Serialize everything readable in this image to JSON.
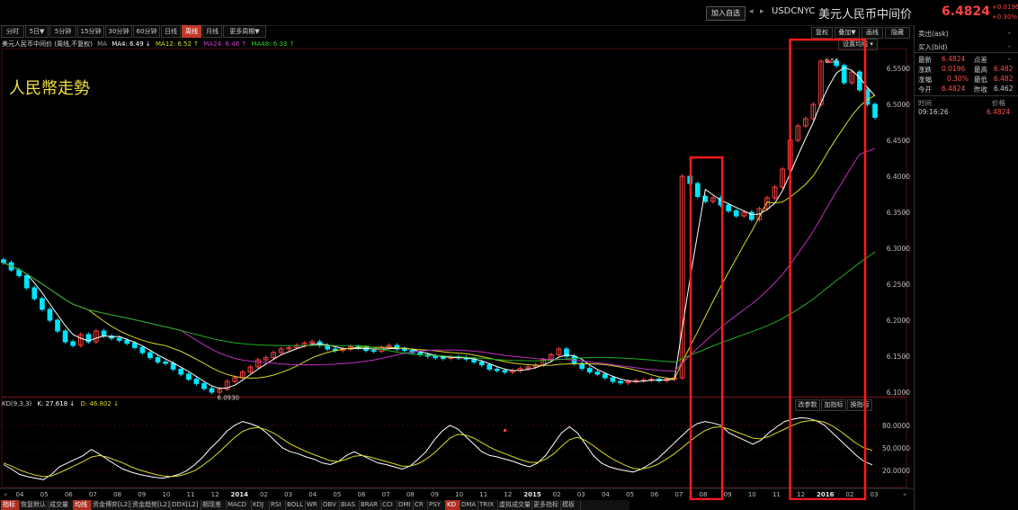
{
  "header": {
    "add_button": "加入自选",
    "symbol": "USDCNYC",
    "symbol_name": "美元人民币中间价",
    "price": "6.4824",
    "change": "+0.0196",
    "change_pct": "+0.30%"
  },
  "toolbar": {
    "periods": [
      "分时",
      "5日▼",
      "5分钟",
      "15分钟",
      "30分钟",
      "60分钟",
      "日线",
      "周线",
      "月线",
      "更多周期▼"
    ],
    "active_index": 7,
    "right_buttons": [
      "复权",
      "叠加▼",
      "画线",
      "隐藏"
    ],
    "ma_dropdown": "设置均线 ▾"
  },
  "legend": {
    "series_label": "美元人民币中间价 (周线,不复权)",
    "ma_label": "MA",
    "ma4": "MA4: 6.49 ↓",
    "ma12": "MA12: 6.52 ↑",
    "ma24": "MA24: 6.46 ↑",
    "ma48": "MA48: 6.33 ↑"
  },
  "annotation_title": "人民幣走勢",
  "kd_legend": {
    "name": "KD(9,3,3)",
    "k": "K: 27.618 ↓",
    "d": "D: 46.802 ↓"
  },
  "kd_buttons": [
    "改参数",
    "加指标",
    "换指标"
  ],
  "quote_panel": {
    "ask_label": "卖出(ask)",
    "ask_value": "-",
    "bid_label": "买入(bid)",
    "bid_value": "-",
    "rows": [
      {
        "l1": "最新",
        "v1": "6.4824",
        "l2": "点差",
        "v2": "-"
      },
      {
        "l1": "涨跌",
        "v1": "0.0196",
        "l2": "最高",
        "v2": "6.482"
      },
      {
        "l1": "涨幅",
        "v1": "0.30%",
        "l2": "最低",
        "v2": "6.482"
      },
      {
        "l1": "今开",
        "v1": "6.4824",
        "l2": "昨收",
        "v2": "6.462"
      }
    ],
    "trade_header_time": "时间",
    "trade_header_price": "价格",
    "trade_time": "09:16:26",
    "trade_price": "6.4824"
  },
  "bottom_tabs": [
    "指标",
    "恢复默认",
    "成交量",
    "均线",
    "资金博弈[L2]",
    "资金趋势[L2]",
    "DDX[L2]",
    "期现差",
    "MACD",
    "KDJ",
    "RSI",
    "BOLL",
    "WR",
    "OBV",
    "BIAS",
    "BRAR",
    "CCI",
    "DMI",
    "CR",
    "PSY",
    "KD",
    "DMA",
    "TRIX",
    "虚拟成交量",
    "更多指标",
    "模板"
  ],
  "bottom_active": [
    0,
    3,
    20
  ],
  "colors": {
    "up": "#ff4040",
    "down": "#00e5ff",
    "ma4": "#ffffff",
    "ma12": "#d9d927",
    "ma24": "#c030c0",
    "ma48": "#20b020",
    "highlight_box": "#ff1a1a",
    "k_line": "#ffffff",
    "d_line": "#d9d927"
  },
  "chart_data": [
    {
      "type": "candlestick",
      "title": "美元人民币中间价 (周线,不复权)",
      "y_ticks": [
        "6.5500",
        "6.5000",
        "6.4500",
        "6.4000",
        "6.3500",
        "6.3000",
        "6.2500",
        "6.2000",
        "6.1500",
        "6.1000"
      ],
      "ylim": [
        6.095,
        6.575
      ],
      "x_tick_labels": [
        "04",
        "05",
        "06",
        "07",
        "08",
        "09",
        "10",
        "11",
        "12",
        "2014",
        "02",
        "03",
        "04",
        "05",
        "06",
        "07",
        "08",
        "09",
        "10",
        "11",
        "12",
        "2015",
        "02",
        "03",
        "04",
        "05",
        "06",
        "07",
        "08",
        "09",
        "10",
        "11",
        "12",
        "2016",
        "02",
        "03"
      ],
      "annotations": [
        {
          "text": "6.0930",
          "value": 6.093
        },
        {
          "text": "6.56",
          "value": 6.56
        }
      ],
      "highlights": [
        [
          "2015-08",
          "2015-09"
        ],
        [
          "2015-12",
          "2016-03"
        ]
      ],
      "closes": [
        6.28,
        6.27,
        6.262,
        6.245,
        6.23,
        6.215,
        6.2,
        6.185,
        6.17,
        6.165,
        6.18,
        6.17,
        6.185,
        6.178,
        6.175,
        6.172,
        6.168,
        6.162,
        6.155,
        6.148,
        6.142,
        6.14,
        6.132,
        6.125,
        6.118,
        6.112,
        6.105,
        6.1,
        6.104,
        6.115,
        6.12,
        6.128,
        6.135,
        6.145,
        6.148,
        6.155,
        6.16,
        6.162,
        6.165,
        6.168,
        6.17,
        6.165,
        6.16,
        6.158,
        6.16,
        6.163,
        6.162,
        6.158,
        6.157,
        6.162,
        6.165,
        6.16,
        6.158,
        6.155,
        6.152,
        6.15,
        6.148,
        6.147,
        6.149,
        6.148,
        6.146,
        6.142,
        6.138,
        6.132,
        6.13,
        6.128,
        6.13,
        6.133,
        6.135,
        6.138,
        6.145,
        6.152,
        6.16,
        6.15,
        6.14,
        6.133,
        6.128,
        6.125,
        6.12,
        6.115,
        6.113,
        6.115,
        6.116,
        6.117,
        6.118,
        6.116,
        6.118,
        6.12,
        6.4,
        6.39,
        6.372,
        6.365,
        6.37,
        6.36,
        6.352,
        6.345,
        6.35,
        6.34,
        6.355,
        6.37,
        6.385,
        6.41,
        6.45,
        6.47,
        6.48,
        6.5,
        6.56,
        6.56,
        6.554,
        6.53,
        6.545,
        6.52,
        6.5,
        6.482
      ],
      "ma_series": [
        {
          "name": "MA4",
          "value": 6.49
        },
        {
          "name": "MA12",
          "value": 6.52
        },
        {
          "name": "MA24",
          "value": 6.46
        },
        {
          "name": "MA48",
          "value": 6.33
        }
      ]
    },
    {
      "type": "line",
      "title": "KD(9,3,3)",
      "y_ticks": [
        "80.0000",
        "50.0000",
        "20.0000"
      ],
      "ylim": [
        0,
        100
      ],
      "series": [
        {
          "name": "K",
          "last": 27.618,
          "values": [
            28,
            22,
            15,
            12,
            10,
            8,
            15,
            25,
            30,
            35,
            40,
            48,
            42,
            35,
            28,
            22,
            18,
            15,
            13,
            11,
            10,
            12,
            15,
            20,
            28,
            38,
            50,
            60,
            72,
            80,
            85,
            82,
            78,
            70,
            60,
            50,
            45,
            42,
            38,
            35,
            30,
            28,
            32,
            40,
            45,
            40,
            35,
            30,
            28,
            25,
            22,
            26,
            35,
            45,
            60,
            72,
            80,
            75,
            65,
            55,
            45,
            40,
            38,
            35,
            32,
            28,
            25,
            30,
            40,
            55,
            70,
            78,
            70,
            55,
            40,
            30,
            25,
            22,
            20,
            18,
            22,
            28,
            35,
            45,
            55,
            65,
            75,
            82,
            85,
            83,
            80,
            70,
            65,
            60,
            55,
            60,
            70,
            78,
            85,
            88,
            90,
            89,
            86,
            80,
            70,
            60,
            50,
            40,
            32,
            27.618
          ]
        },
        {
          "name": "D",
          "last": 46.802,
          "values": [
            30,
            26,
            21,
            17,
            14,
            12,
            13,
            17,
            22,
            27,
            32,
            38,
            40,
            38,
            34,
            30,
            25,
            21,
            18,
            15,
            13,
            12,
            13,
            16,
            20,
            27,
            35,
            44,
            54,
            64,
            72,
            76,
            77,
            74,
            69,
            62,
            55,
            50,
            45,
            41,
            37,
            33,
            32,
            35,
            39,
            40,
            38,
            35,
            32,
            29,
            26,
            26,
            29,
            35,
            43,
            53,
            63,
            68,
            67,
            63,
            57,
            51,
            46,
            42,
            38,
            34,
            31,
            31,
            35,
            42,
            52,
            61,
            64,
            60,
            53,
            45,
            38,
            32,
            27,
            23,
            22,
            24,
            28,
            34,
            41,
            49,
            58,
            66,
            73,
            77,
            78,
            75,
            71,
            67,
            63,
            62,
            65,
            70,
            75,
            80,
            84,
            86,
            86,
            84,
            79,
            72,
            64,
            56,
            50,
            46.802
          ]
        }
      ]
    }
  ]
}
